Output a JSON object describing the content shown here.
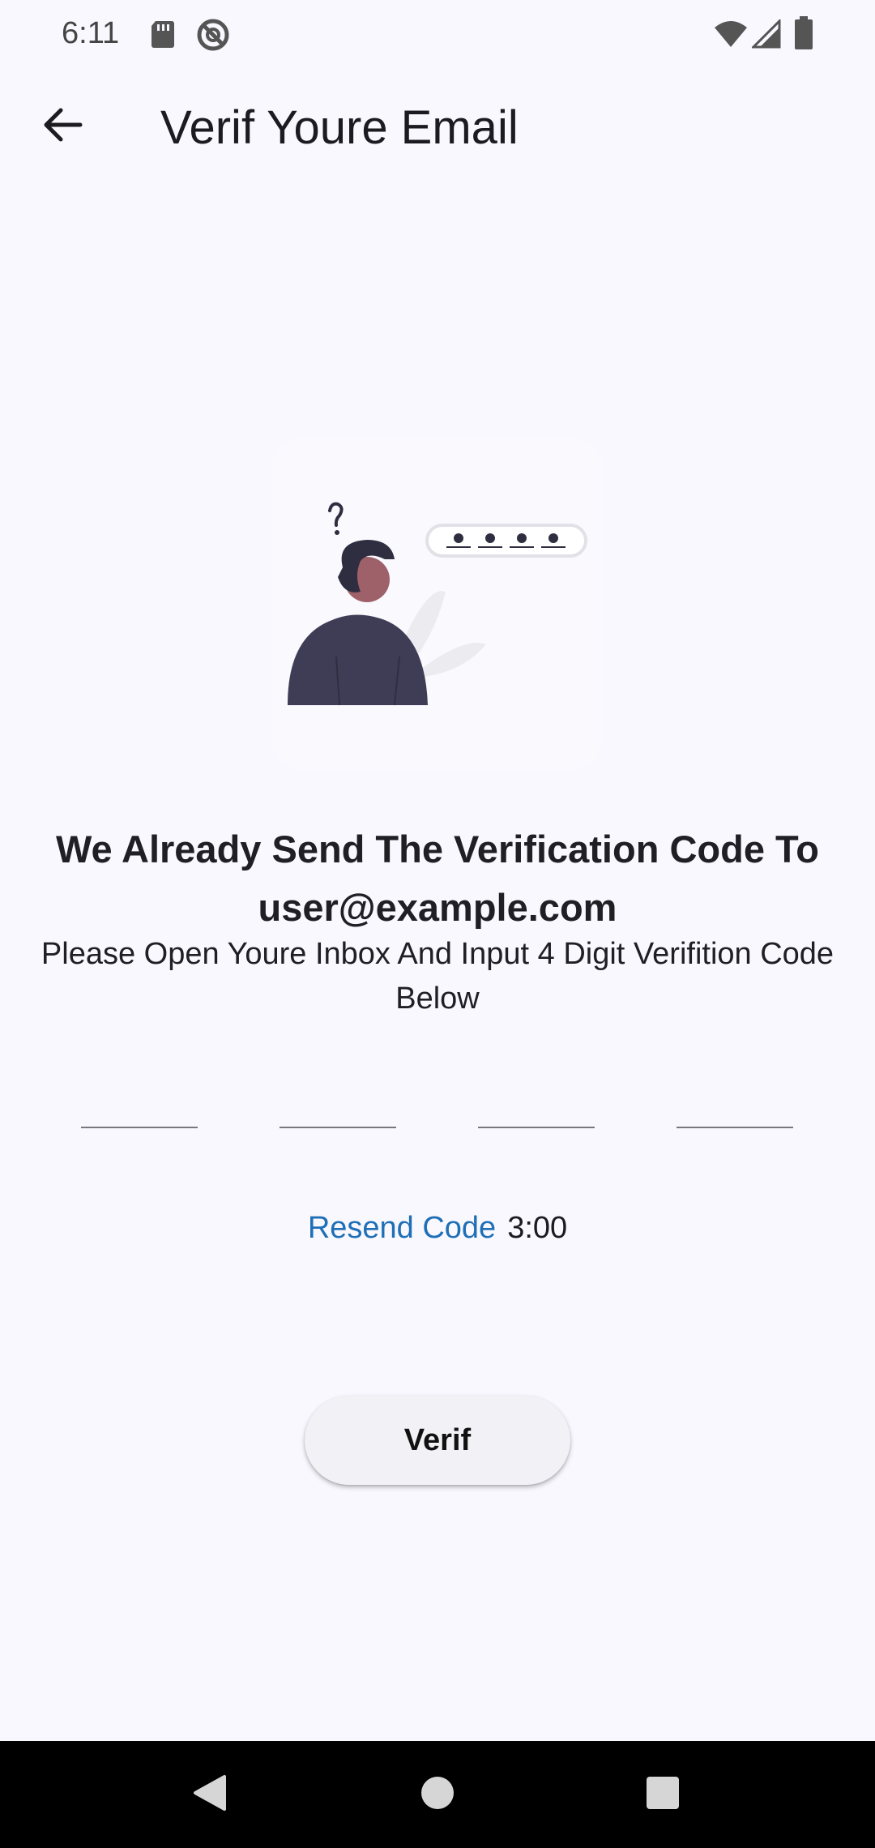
{
  "status_bar": {
    "time": "6:11",
    "left_icons": [
      "sd-card-icon",
      "do-not-disturb-icon"
    ],
    "right_icons": [
      "wifi-icon",
      "cell-signal-icon",
      "battery-icon"
    ]
  },
  "app_bar": {
    "title": "Verif Youre Email",
    "back_icon": "arrow-back-icon"
  },
  "illustration": {
    "subject": "person-with-question-mark-and-code-bubble",
    "bubble_dots": 4
  },
  "content": {
    "headline": "We Already Send The Verification Code To user@example.com",
    "subline": "Please Open Youre Inbox And Input 4 Digit Verifition Code Below"
  },
  "code_fields": [
    {
      "value": ""
    },
    {
      "value": ""
    },
    {
      "value": ""
    },
    {
      "value": ""
    }
  ],
  "resend": {
    "label": "Resend Code",
    "timer": "3:00"
  },
  "verify_button": {
    "label": "Verif"
  },
  "nav_bar": {
    "buttons": [
      "back-triangle-icon",
      "home-circle-icon",
      "recents-square-icon"
    ]
  },
  "colors": {
    "background": "#f9f8fe",
    "link": "#1f6fb7",
    "text": "#1c1b1f",
    "figure_dark": "#2f2e41",
    "figure_jacket": "#3f3d56",
    "figure_skin": "#9e616a"
  }
}
